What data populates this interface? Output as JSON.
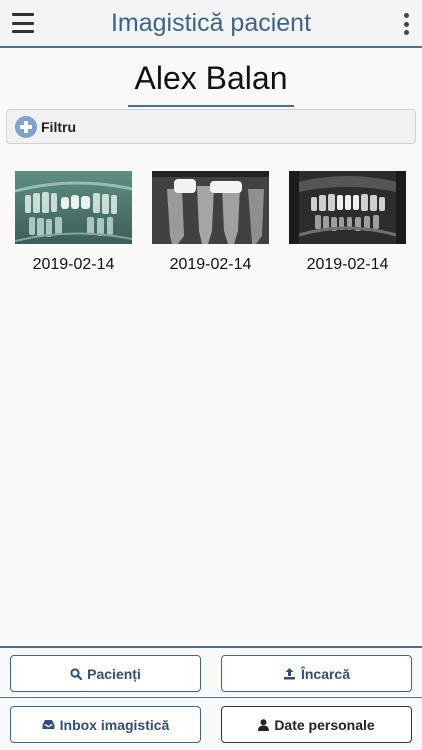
{
  "header": {
    "title": "Imagistică pacient",
    "menu_icon": "hamburger-menu-icon",
    "more_icon": "kebab-menu-icon"
  },
  "patient": {
    "name": "Alex Balan"
  },
  "filter": {
    "label": "Filtru",
    "icon": "plus-circle-icon"
  },
  "images": [
    {
      "date": "2019-02-14",
      "kind": "panoramic x-ray"
    },
    {
      "date": "2019-02-14",
      "kind": "periapical x-ray"
    },
    {
      "date": "2019-02-14",
      "kind": "panoramic x-ray"
    }
  ],
  "footer": {
    "patients": {
      "label": "Pacienți",
      "icon": "search-icon"
    },
    "upload": {
      "label": "Încarcă",
      "icon": "upload-icon"
    },
    "inbox": {
      "label": "Inbox imagistică",
      "icon": "inbox-icon"
    },
    "personal": {
      "label": "Date personale",
      "icon": "user-icon"
    }
  },
  "colors": {
    "accent": "#3c6390",
    "border": "#4a6e96",
    "background": "#f9f9f9"
  }
}
